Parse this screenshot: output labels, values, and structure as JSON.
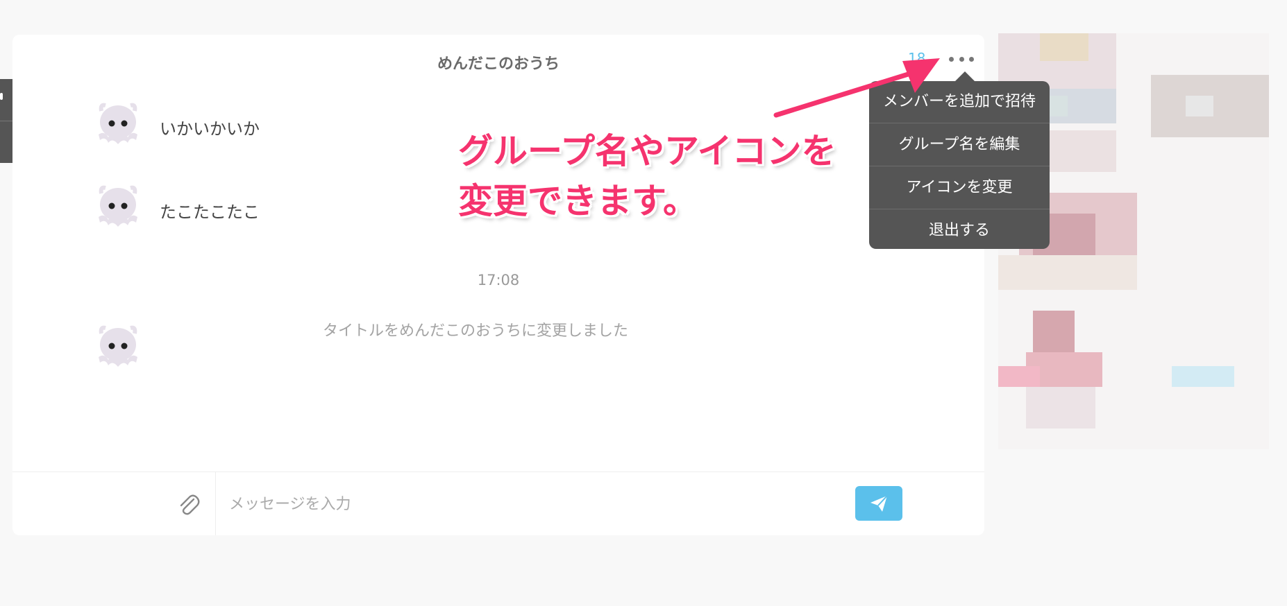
{
  "chat": {
    "title": "めんだこのおうち",
    "member_count": "18",
    "messages": [
      {
        "avatar_icon": "octopus-icon",
        "text": "いかいかいか"
      },
      {
        "avatar_icon": "octopus-icon",
        "text": "たこたこたこ"
      }
    ],
    "timestamp": "17:08",
    "system_message": "タイトルをめんだこのおうちに変更しました"
  },
  "menu": {
    "items": [
      {
        "label": "メンバーを追加で招待"
      },
      {
        "label": "グループ名を編集"
      },
      {
        "label": "アイコンを変更"
      },
      {
        "label": "退出する"
      }
    ]
  },
  "input": {
    "placeholder": "メッセージを入力",
    "attach_icon": "paperclip-icon",
    "send_icon": "paper-plane-icon"
  },
  "annotation": {
    "line1": "グループ名やアイコンを",
    "line2": "変更できます。",
    "color": "#f5336e"
  },
  "colors": {
    "accent": "#5bc0eb",
    "menu_bg": "#555555"
  }
}
